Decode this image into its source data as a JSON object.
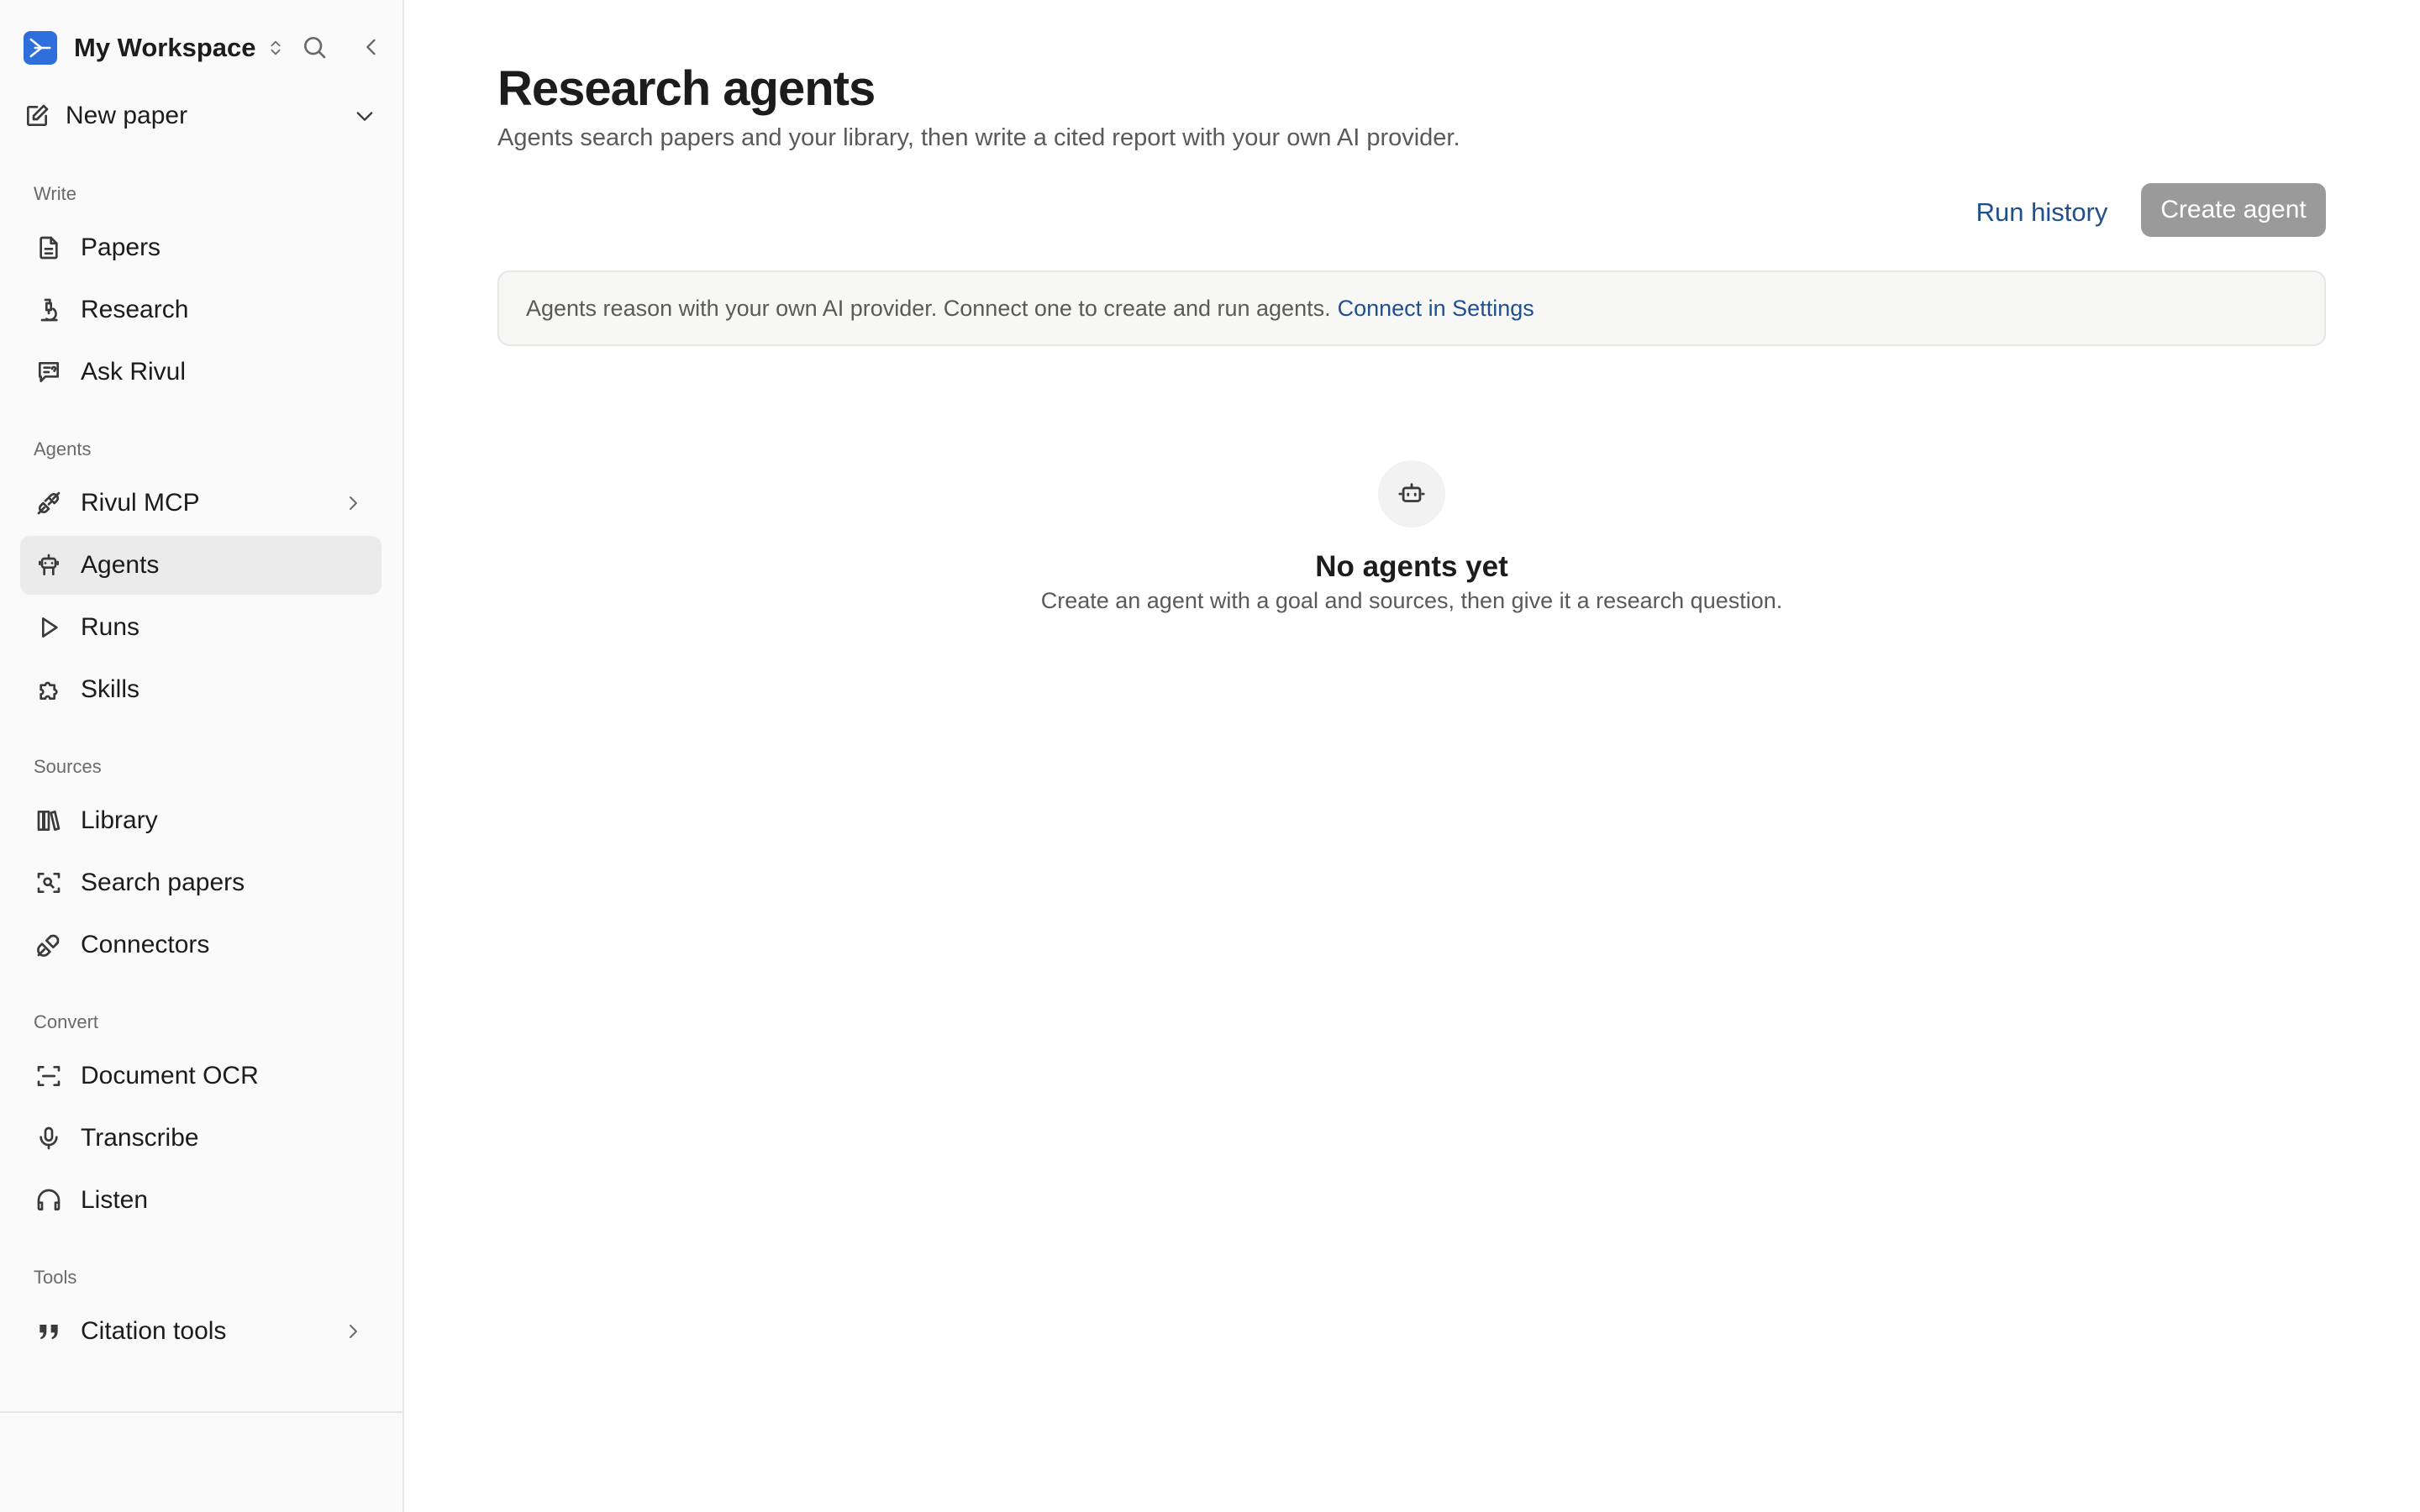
{
  "workspace": {
    "name": "My Workspace"
  },
  "new_paper": {
    "label": "New paper"
  },
  "sidebar": {
    "sections": {
      "write": "Write",
      "agents": "Agents",
      "sources": "Sources",
      "convert": "Convert",
      "tools": "Tools"
    },
    "items": {
      "papers": "Papers",
      "research": "Research",
      "ask_rivul": "Ask Rivul",
      "rivul_mcp": "Rivul MCP",
      "agents": "Agents",
      "runs": "Runs",
      "skills": "Skills",
      "library": "Library",
      "search_papers": "Search papers",
      "connectors": "Connectors",
      "document_ocr": "Document OCR",
      "transcribe": "Transcribe",
      "listen": "Listen",
      "citation_tools": "Citation tools"
    },
    "active_item": "agents"
  },
  "main": {
    "title": "Research agents",
    "subtitle": "Agents search papers and your library, then write a cited report with your own AI provider.",
    "run_history": "Run history",
    "create_agent": "Create agent",
    "banner": {
      "text": "Agents reason with your own AI provider. Connect one to create and run agents.",
      "link": "Connect in Settings"
    },
    "empty": {
      "title": "No agents yet",
      "subtitle": "Create an agent with a goal and sources, then give it a research question."
    }
  },
  "colors": {
    "brand": "#2f6fdc",
    "link": "#1f4f8c",
    "disabled_button": "#9a9a9a",
    "active_nav": "#ebebeb"
  }
}
